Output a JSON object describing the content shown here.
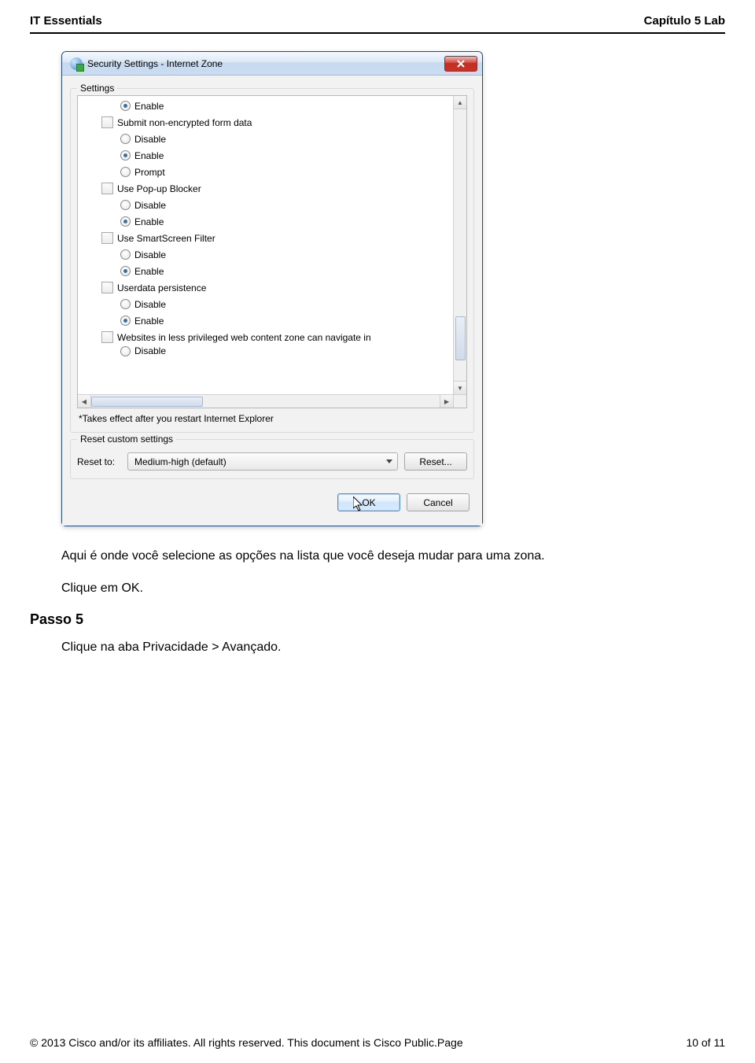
{
  "doc": {
    "header_left": "IT Essentials",
    "header_right": "Capítulo 5 Lab",
    "body_p1": "Aqui é onde você selecione as opções na lista que você deseja mudar para uma zona.",
    "body_p2": "Clique em OK.",
    "step_title": "Passo 5",
    "step_body": "Clique na aba Privacidade > Avançado.",
    "footer_left": "© 2013 Cisco and/or its affiliates. All rights reserved. This document is Cisco Public.Page",
    "footer_right": "10 of 11"
  },
  "dialog": {
    "title": "Security Settings - Internet Zone",
    "group_settings": "Settings",
    "group_reset": "Reset custom settings",
    "footnote": "*Takes effect after you restart Internet Explorer",
    "reset_to_label": "Reset to:",
    "reset_combo": "Medium-high (default)",
    "reset_btn": "Reset...",
    "ok_btn": "OK",
    "cancel_btn": "Cancel",
    "rows": {
      "enable_top": "Enable",
      "submit": "Submit non-encrypted form data",
      "disable1": "Disable",
      "enable1": "Enable",
      "prompt1": "Prompt",
      "popup": "Use Pop-up Blocker",
      "disable2": "Disable",
      "enable2": "Enable",
      "smartscreen": "Use SmartScreen Filter",
      "disable3": "Disable",
      "enable3": "Enable",
      "userdata": "Userdata persistence",
      "disable4": "Disable",
      "enable4": "Enable",
      "websites": "Websites in less privileged web content zone can navigate in",
      "disable5": "Disable"
    }
  }
}
